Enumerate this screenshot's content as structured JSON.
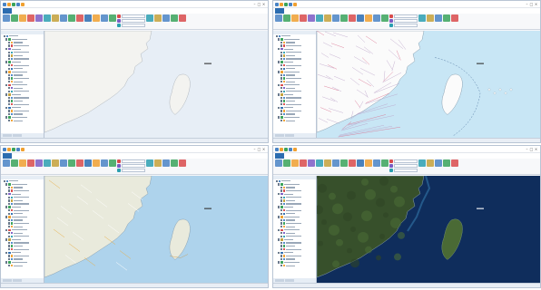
{
  "panes": [
    {
      "map_style": "vector-gray",
      "ocean": "#e7eef6",
      "land": "#f3f3f0",
      "label_color": "#333333"
    },
    {
      "map_style": "vector-admin",
      "ocean": "#c8e6f5",
      "land": "#fbfbfb",
      "label_color": "#333333"
    },
    {
      "map_style": "street",
      "ocean": "#aed3ec",
      "land": "#e9eadc",
      "label_color": "#333333"
    },
    {
      "map_style": "satellite",
      "ocean": "#0f2d5c",
      "land": "#3d5a2e",
      "label_color": "#ffffff"
    }
  ],
  "icons": [
    "quick-access-icon",
    "ribbon-tool-icon",
    "layer-checkbox-icon",
    "layer-symbol-icon",
    "minimize-icon",
    "maximize-icon",
    "close-icon"
  ],
  "accent": "#2b6cb0"
}
